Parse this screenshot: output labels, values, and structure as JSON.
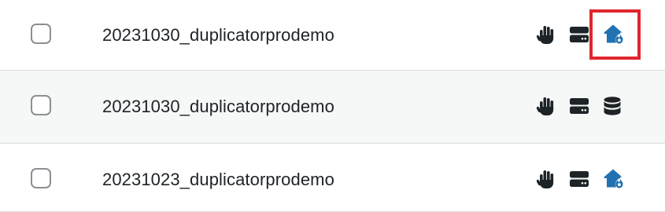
{
  "packages": [
    {
      "name": "20231030_duplicatorprodemo",
      "icons": [
        "hand-icon",
        "server-icon",
        "home-fire-icon"
      ],
      "highlighted": true
    },
    {
      "name": "20231030_duplicatorprodemo",
      "icons": [
        "hand-icon",
        "server-icon",
        "database-icon"
      ],
      "highlighted": false
    },
    {
      "name": "20231023_duplicatorprodemo",
      "icons": [
        "hand-icon",
        "server-icon",
        "home-fire-icon"
      ],
      "highlighted": false
    }
  ],
  "colors": {
    "icon_dark": "#1d2327",
    "icon_accent": "#2271b1",
    "highlight_border": "#e0262d",
    "alt_row_background": "#f6f7f7"
  }
}
